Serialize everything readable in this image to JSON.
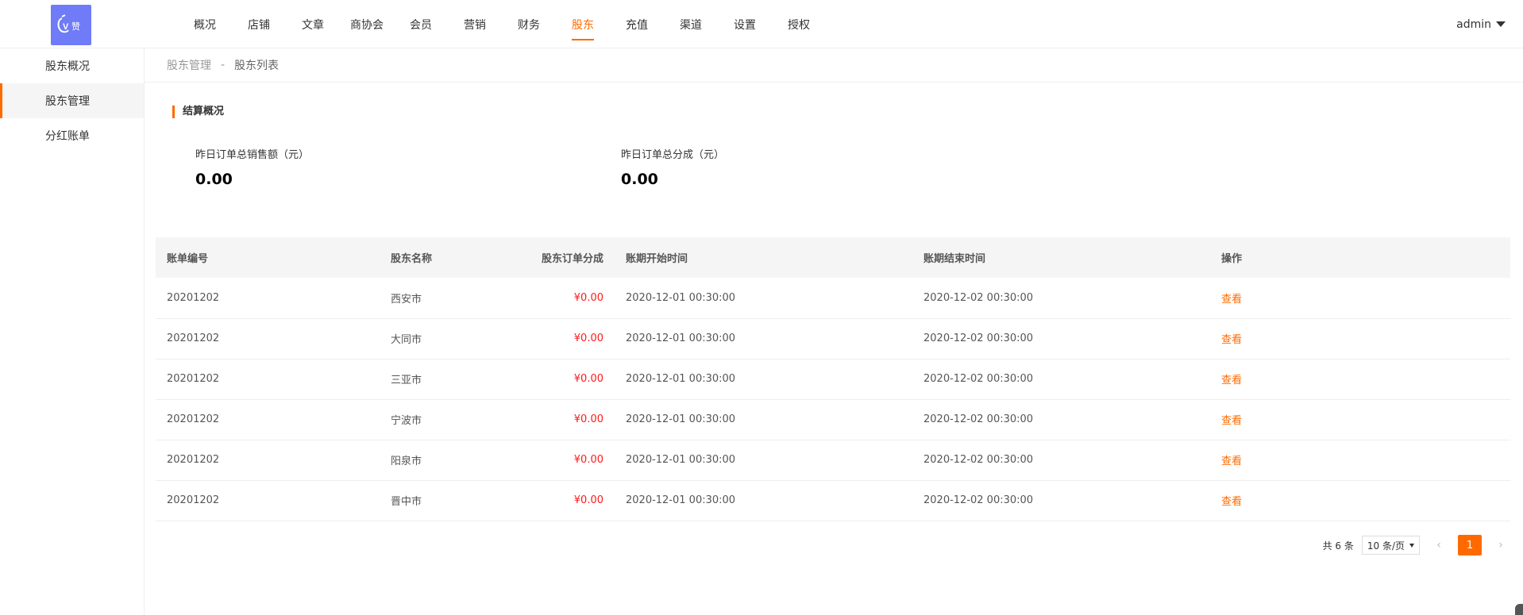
{
  "colors": {
    "accent": "#ff6a00",
    "amount": "#ff1a1a",
    "logo_bg": "#6f7bf7"
  },
  "logo": {
    "text": "赞",
    "icon": "ev-logo"
  },
  "nav": {
    "items": [
      {
        "label": "概况"
      },
      {
        "label": "店铺"
      },
      {
        "label": "文章"
      },
      {
        "label": "商协会"
      },
      {
        "label": "会员"
      },
      {
        "label": "营销"
      },
      {
        "label": "财务"
      },
      {
        "label": "股东",
        "active": true
      },
      {
        "label": "充值"
      },
      {
        "label": "渠道"
      },
      {
        "label": "设置"
      },
      {
        "label": "授权"
      }
    ],
    "user": "admin"
  },
  "sidebar": {
    "items": [
      {
        "label": "股东概况"
      },
      {
        "label": "股东管理",
        "active": true
      },
      {
        "label": "分红账单"
      }
    ]
  },
  "breadcrumb": {
    "parent": "股东管理",
    "separator": "-",
    "current": "股东列表"
  },
  "summary": {
    "title": "结算概况",
    "stats": [
      {
        "label": "昨日订单总销售额（元）",
        "value": "0.00"
      },
      {
        "label": "昨日订单总分成（元）",
        "value": "0.00"
      }
    ]
  },
  "table": {
    "headers": [
      "账单编号",
      "股东名称",
      "股东订单分成",
      "账期开始时间",
      "账期结束时间",
      "操作"
    ],
    "rows": [
      {
        "id": "20201202",
        "name": "西安市",
        "amount": "¥0.00",
        "start": "2020-12-01 00:30:00",
        "end": "2020-12-02 00:30:00",
        "action": "查看"
      },
      {
        "id": "20201202",
        "name": "大同市",
        "amount": "¥0.00",
        "start": "2020-12-01 00:30:00",
        "end": "2020-12-02 00:30:00",
        "action": "查看"
      },
      {
        "id": "20201202",
        "name": "三亚市",
        "amount": "¥0.00",
        "start": "2020-12-01 00:30:00",
        "end": "2020-12-02 00:30:00",
        "action": "查看"
      },
      {
        "id": "20201202",
        "name": "宁波市",
        "amount": "¥0.00",
        "start": "2020-12-01 00:30:00",
        "end": "2020-12-02 00:30:00",
        "action": "查看"
      },
      {
        "id": "20201202",
        "name": "阳泉市",
        "amount": "¥0.00",
        "start": "2020-12-01 00:30:00",
        "end": "2020-12-02 00:30:00",
        "action": "查看"
      },
      {
        "id": "20201202",
        "name": "晋中市",
        "amount": "¥0.00",
        "start": "2020-12-01 00:30:00",
        "end": "2020-12-02 00:30:00",
        "action": "查看"
      }
    ]
  },
  "pagination": {
    "total_text": "共 6 条",
    "page_size": "10 条/页",
    "current_page": "1",
    "prev_icon": "chevron-left-icon",
    "next_icon": "chevron-right-icon"
  }
}
